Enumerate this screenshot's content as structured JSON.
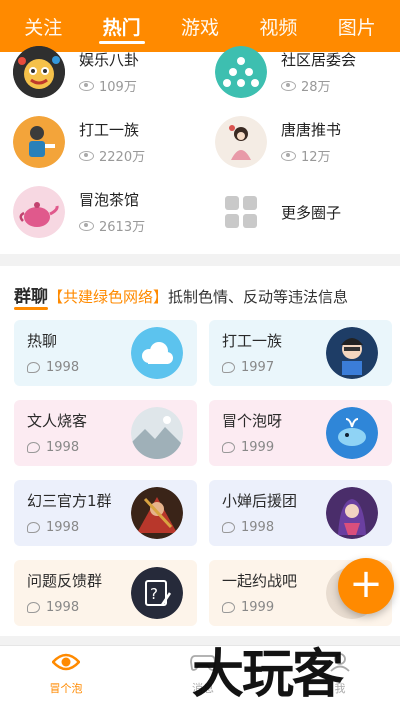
{
  "tabs": [
    {
      "label": "关注"
    },
    {
      "label": "热门",
      "active": true
    },
    {
      "label": "游戏"
    },
    {
      "label": "视频"
    },
    {
      "label": "图片"
    }
  ],
  "circles": [
    {
      "name": "娱乐八卦",
      "views": "109万",
      "icon": "gossip-avatar-icon"
    },
    {
      "name": "社区居委会",
      "views": "28万",
      "icon": "community-avatar-icon"
    },
    {
      "name": "打工一族",
      "views": "2220万",
      "icon": "worker-avatar-icon"
    },
    {
      "name": "唐唐推书",
      "views": "12万",
      "icon": "book-avatar-icon"
    },
    {
      "name": "冒泡茶馆",
      "views": "2613万",
      "icon": "teapot-avatar-icon"
    },
    {
      "name": "更多圈子",
      "icon": "grid-icon"
    }
  ],
  "groups": {
    "title": "群聊",
    "tag": "【共建绿色网络】",
    "notice": "抵制色情、反动等违法信息",
    "cards": [
      {
        "name": "热聊",
        "count": "1998",
        "bg": "#eaf6fb"
      },
      {
        "name": "打工一族",
        "count": "1997",
        "bg": "#eaf6fb"
      },
      {
        "name": "文人烧客",
        "count": "1998",
        "bg": "#fcebf2"
      },
      {
        "name": "冒个泡呀",
        "count": "1999",
        "bg": "#fcebf2"
      },
      {
        "name": "幻三官方1群",
        "count": "1998",
        "bg": "#ecf0fb"
      },
      {
        "name": "小婵后援团",
        "count": "1998",
        "bg": "#ecf0fb"
      },
      {
        "name": "问题反馈群",
        "count": "1998",
        "bg": "#fdf4ea"
      },
      {
        "name": "一起约战吧",
        "count": "1999",
        "bg": "#fdf4ea"
      }
    ]
  },
  "fab": {
    "label": "+"
  },
  "bottom_nav": [
    {
      "label": "冒个泡",
      "active": true
    },
    {
      "label": "消息"
    },
    {
      "label": "我"
    }
  ],
  "watermark": "大玩客",
  "colors": {
    "accent": "#ff8a00"
  }
}
